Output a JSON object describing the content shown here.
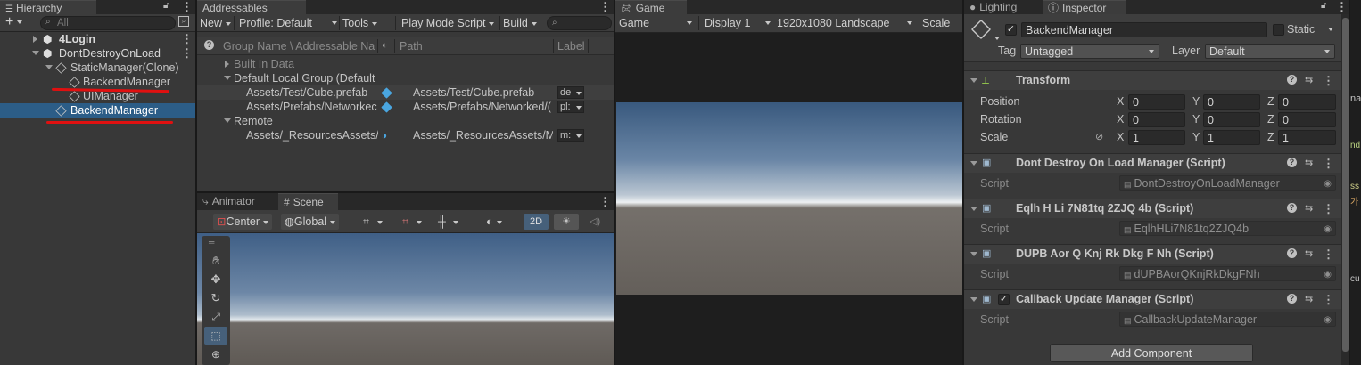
{
  "hierarchy": {
    "tab": "Hierarchy",
    "add_label": "+",
    "search_placeholder": "All",
    "items": [
      {
        "label": "4Login"
      },
      {
        "label": "DontDestroyOnLoad"
      },
      {
        "label": "StaticManager(Clone)"
      },
      {
        "label": "BackendManager"
      },
      {
        "label": "UIManager"
      },
      {
        "label": "BackendManager"
      }
    ]
  },
  "addressables": {
    "tab": "Addressables Groups",
    "toolbar": {
      "new_label": "New",
      "profile_label": "Profile: Default",
      "tools_label": "Tools",
      "play_mode_label": "Play Mode Script",
      "build_label": "Build"
    },
    "columns": {
      "group_name": "Group Name \\ Addressable Nai",
      "path": "Path",
      "labels": "Label"
    },
    "rows": [
      {
        "name": "Built In Data",
        "path": "",
        "label": ""
      },
      {
        "name": "Default Local Group (Default",
        "path": "",
        "label": ""
      },
      {
        "name": "Assets/Test/Cube.prefab",
        "path": "Assets/Test/Cube.prefab",
        "label": "de"
      },
      {
        "name": "Assets/Prefabs/Networkec",
        "path": "Assets/Prefabs/Networked/(",
        "label": "pl:"
      },
      {
        "name": "Remote",
        "path": "",
        "label": ""
      },
      {
        "name": "Assets/_ResourcesAssets/",
        "path": "Assets/_ResourcesAssets/M",
        "label": "m:"
      }
    ]
  },
  "scene": {
    "tabs": {
      "animator": "Animator",
      "scene": "Scene"
    },
    "toolbar": {
      "pivot": "Center",
      "space": "Global",
      "mode_2d": "2D"
    }
  },
  "game": {
    "tab": "Game",
    "toolbar": {
      "view": "Game",
      "display": "Display 1",
      "resolution": "1920x1080 Landscape",
      "scale": "Scale"
    }
  },
  "inspector": {
    "tabs": {
      "lighting": "Lighting",
      "inspector": "Inspector"
    },
    "object_name": "BackendManager",
    "static_label": "Static",
    "tag_label": "Tag",
    "tag_value": "Untagged",
    "layer_label": "Layer",
    "layer_value": "Default",
    "transform": {
      "title": "Transform",
      "position_label": "Position",
      "rotation_label": "Rotation",
      "scale_label": "Scale",
      "x": "X",
      "y": "Y",
      "z": "Z",
      "position": [
        "0",
        "0",
        "0"
      ],
      "rotation": [
        "0",
        "0",
        "0"
      ],
      "scale": [
        "1",
        "1",
        "1"
      ]
    },
    "components": [
      {
        "title": "Dont Destroy On Load Manager (Script)",
        "script_label": "Script",
        "script_value": "DontDestroyOnLoadManager"
      },
      {
        "title": "Eqlh H Li 7N81tq 2ZJQ 4b (Script)",
        "script_label": "Script",
        "script_value": "EqlhHLi7N81tq2ZJQ4b"
      },
      {
        "title": "DUPB Aor Q Knj Rk Dkg F Nh (Script)",
        "script_label": "Script",
        "script_value": "dUPBAorQKnjRkDkgFNh"
      },
      {
        "title": "Callback Update Manager (Script)",
        "script_label": "Script",
        "script_value": "CallbackUpdateManager"
      }
    ],
    "add_component": "Add Component"
  },
  "right_edge": {
    "snippet1": "na",
    "snippet2": "nd",
    "snippet3": "ss",
    "snippet4": "가",
    "snippet5": "cu"
  },
  "colors": {
    "selection": "#2c5d87",
    "annotation": "#e01010"
  }
}
